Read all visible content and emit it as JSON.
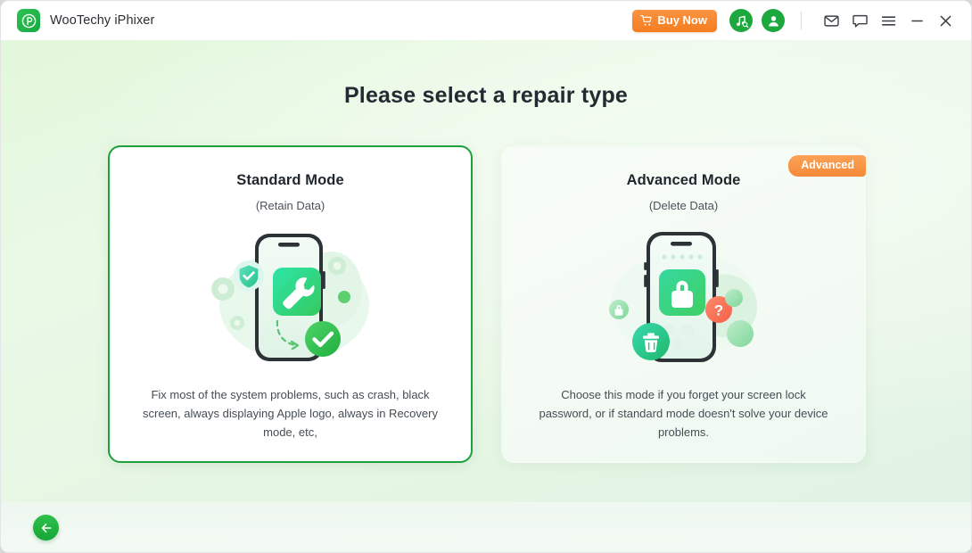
{
  "window": {
    "brand_title": "WooTechy iPhixer",
    "logo_icon": "wootechy-p-logo-icon"
  },
  "titlebar": {
    "buy_now_label": "Buy Now",
    "cart_icon": "shopping-cart-icon",
    "music_search_icon": "music-search-icon",
    "account_icon": "user-account-icon",
    "mail_icon": "mail-icon",
    "feedback_icon": "chat-bubble-icon",
    "menu_icon": "hamburger-menu-icon",
    "minimize_icon": "minimize-icon",
    "close_icon": "close-icon"
  },
  "main": {
    "heading": "Please select a repair type",
    "cards": [
      {
        "title": "Standard Mode",
        "subtitle": "(Retain Data)",
        "description": "Fix most of the system problems, such as crash, black screen, always displaying Apple logo, always in Recovery mode, etc,",
        "illustration_icon": "phone-wrench-repair-illustration",
        "selected": true,
        "badge": ""
      },
      {
        "title": "Advanced Mode",
        "subtitle": "(Delete Data)",
        "description": "Choose this mode if you forget your screen lock password, or if standard mode doesn't solve your device problems.",
        "illustration_icon": "phone-lock-erase-illustration",
        "selected": false,
        "badge": "Advanced"
      }
    ]
  },
  "footer": {
    "back_icon": "arrow-left-icon"
  },
  "colors": {
    "brand_green": "#1da83d",
    "selected_border": "#1ea03a",
    "buy_now_orange": "#f47d20",
    "ribbon_orange": "#f5883a",
    "page_background": "#e6f6e4",
    "card_background": "#ffffff"
  }
}
